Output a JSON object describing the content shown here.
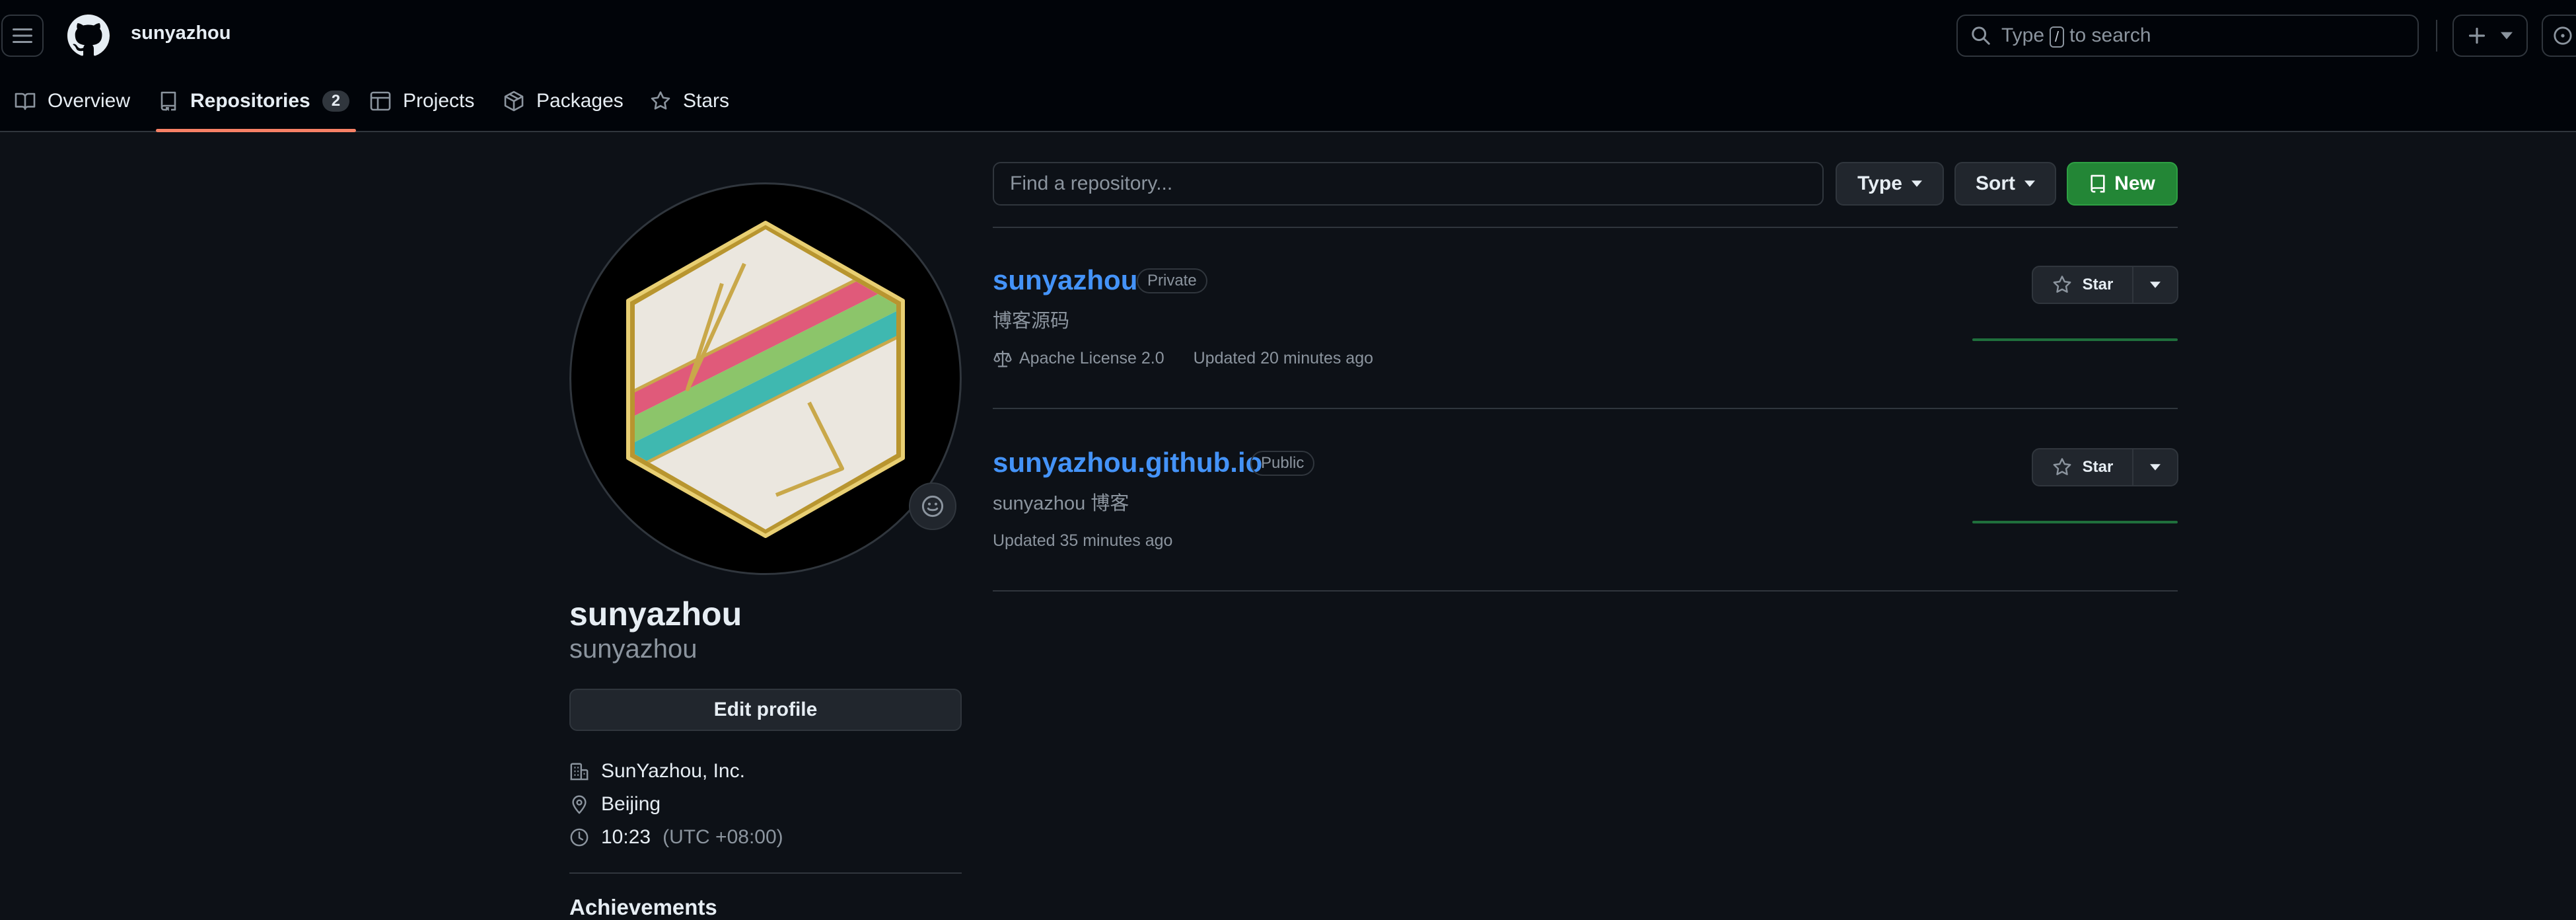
{
  "header": {
    "username": "sunyazhou",
    "search": {
      "prefix": "Type",
      "key": "/",
      "suffix": "to search"
    }
  },
  "tabs": [
    {
      "label": "Overview"
    },
    {
      "label": "Repositories",
      "count": "2"
    },
    {
      "label": "Projects"
    },
    {
      "label": "Packages"
    },
    {
      "label": "Stars"
    }
  ],
  "profile": {
    "name": "sunyazhou",
    "login": "sunyazhou",
    "edit_label": "Edit profile",
    "company": "SunYazhou, Inc.",
    "location": "Beijing",
    "time": "10:23",
    "timezone": "(UTC +08:00)",
    "achievements_label": "Achievements"
  },
  "filters": {
    "placeholder": "Find a repository...",
    "type_label": "Type",
    "sort_label": "Sort",
    "new_label": "New"
  },
  "repos": [
    {
      "name": "sunyazhou",
      "visibility": "Private",
      "description": "博客源码",
      "license": "Apache License 2.0",
      "updated": "Updated 20 minutes ago",
      "star_label": "Star"
    },
    {
      "name": "sunyazhou.github.io",
      "visibility": "Public",
      "description": "sunyazhou 博客",
      "updated": "Updated 35 minutes ago",
      "star_label": "Star"
    }
  ],
  "colors": {
    "accent_link": "#4493f8",
    "new_button": "#238636",
    "active_tab_underline": "#f78166",
    "avatar_stripe_pink": "#e05a7a",
    "avatar_stripe_green": "#8cc56a",
    "avatar_stripe_teal": "#3fb8b0"
  }
}
